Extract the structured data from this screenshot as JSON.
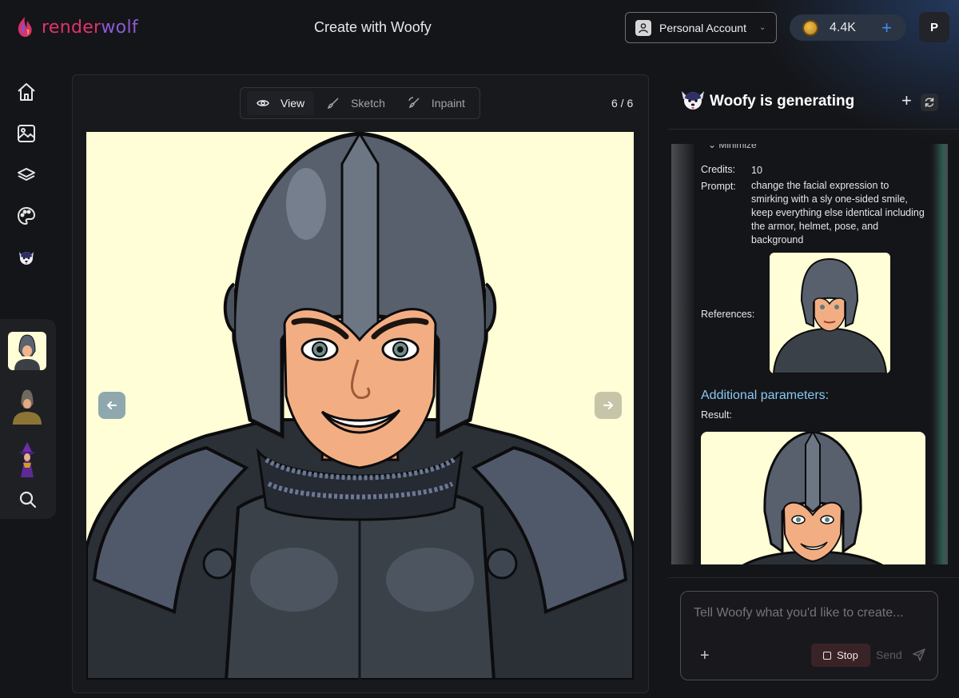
{
  "header": {
    "logo_part1": "render",
    "logo_part2": "wolf",
    "page_title": "Create with Woofy",
    "account_label": "Personal Account",
    "credits": "4.4K",
    "avatar_initial": "P"
  },
  "sidebar": {
    "items": [
      {
        "name": "home",
        "icon": "home-icon"
      },
      {
        "name": "gallery",
        "icon": "image-icon"
      },
      {
        "name": "layers",
        "icon": "layers-icon"
      },
      {
        "name": "palette",
        "icon": "palette-icon"
      },
      {
        "name": "woofy",
        "icon": "woofy-icon"
      }
    ],
    "thumbnails": [
      "knight-helmet-thumbnail",
      "golden-knight-thumbnail",
      "purple-witch-thumbnail"
    ],
    "search_icon": "search-icon"
  },
  "canvas": {
    "modes": [
      {
        "label": "View",
        "icon": "eye-icon",
        "active": true
      },
      {
        "label": "Sketch",
        "icon": "brush-icon",
        "active": false
      },
      {
        "label": "Inpaint",
        "icon": "inpaint-brush-icon",
        "active": false
      }
    ],
    "counter": "6 / 6",
    "background_color": "#fffed6"
  },
  "chat": {
    "title": "Woofy is generating",
    "minimize_label": "Minimize",
    "credits_label": "Credits:",
    "credits_value": "10",
    "prompt_label": "Prompt:",
    "prompt_value": "change the facial expression to smirking with a sly one-sided smile, keep everything else identical including the armor, helmet, pose, and background",
    "references_label": "References:",
    "additional_params_label": "Additional parameters:",
    "result_label": "Result:",
    "composer_placeholder": "Tell Woofy what you'd like to create...",
    "stop_label": "Stop",
    "send_label": "Send"
  },
  "colors": {
    "accent_blue": "#3d8ef5",
    "link_blue": "#89c9f3",
    "logo_pink": "#e0336b",
    "logo_purple": "#8f5ad6"
  }
}
